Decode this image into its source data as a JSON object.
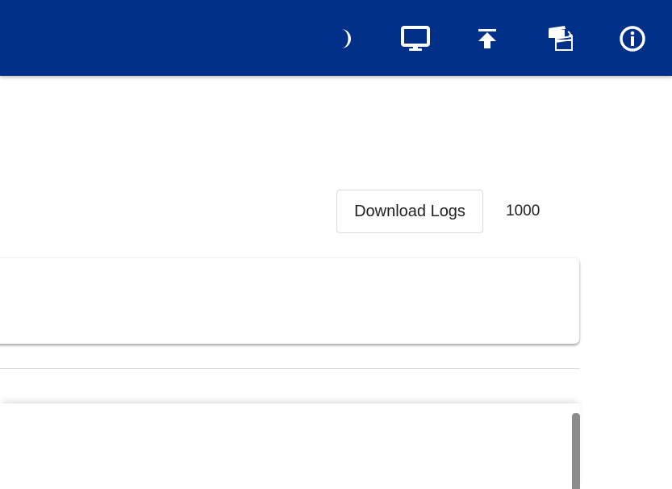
{
  "header": {
    "background_color": "#003087",
    "icons": [
      {
        "name": "moon-icon",
        "title": "Toggle dark mode"
      },
      {
        "name": "monitor-icon",
        "title": "Display"
      },
      {
        "name": "upload-icon",
        "title": "Upload"
      },
      {
        "name": "clapperboard-icon",
        "title": "Media"
      },
      {
        "name": "info-icon",
        "title": "Info"
      }
    ]
  },
  "toolbar": {
    "download_logs_label": "Download Logs",
    "log_count": "1000"
  }
}
